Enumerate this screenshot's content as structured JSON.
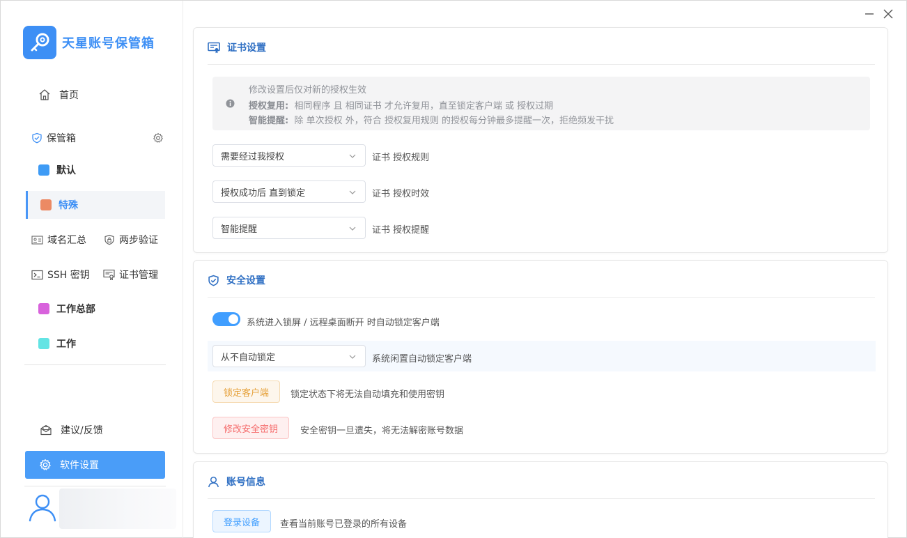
{
  "window": {
    "minimize_icon": "minimize-icon",
    "close_icon": "close-icon"
  },
  "app": {
    "name": "天星账号保管箱",
    "accent": "#3d8ff5"
  },
  "sidebar": {
    "home": "首页",
    "vault_header": "保管箱",
    "vaults": [
      {
        "label": "默认",
        "color": "#3e9bf5"
      },
      {
        "label": "特殊",
        "color": "#ec8a64",
        "selected": true
      },
      {
        "label": "工作总部",
        "color": "#d862dc"
      },
      {
        "label": "工作",
        "color": "#63e4e4"
      }
    ],
    "tools": {
      "domain": "域名汇总",
      "two_factor": "两步验证",
      "ssh": "SSH 密钥",
      "cert": "证书管理"
    },
    "feedback": "建议/反馈",
    "settings": "软件设置"
  },
  "cert_settings": {
    "title": "证书设置",
    "notice": {
      "line1": "修改设置后仅对新的授权生效",
      "reuse_label": "授权复用:",
      "reuse_text": "相同程序 且 相同证书 才允许复用，直至锁定客户端 或 授权过期",
      "remind_label": "智能提醒:",
      "remind_text": "除 单次授权 外，符合 授权复用规则 的授权每分钟最多提醒一次，拒绝频发干扰"
    },
    "rule": {
      "value": "需要经过我授权",
      "label": "证书 授权规则"
    },
    "duration": {
      "value": "授权成功后 直到锁定",
      "label": "证书 授权时效"
    },
    "remind": {
      "value": "智能提醒",
      "label": "证书 授权提醒"
    }
  },
  "security_settings": {
    "title": "安全设置",
    "auto_lock_toggle": {
      "on": true,
      "label": "系统进入锁屏 / 远程桌面断开 时自动锁定客户端"
    },
    "idle_lock": {
      "value": "从不自动锁定",
      "label": "系统闲置自动锁定客户端"
    },
    "lock_button": "锁定客户端",
    "lock_desc": "锁定状态下将无法自动填充和使用密钥",
    "change_key_button": "修改安全密钥",
    "change_key_desc": "安全密钥一旦遗失，将无法解密账号数据"
  },
  "account_info": {
    "title": "账号信息",
    "devices_button": "登录设备",
    "devices_desc": "查看当前账号已登录的所有设备"
  }
}
